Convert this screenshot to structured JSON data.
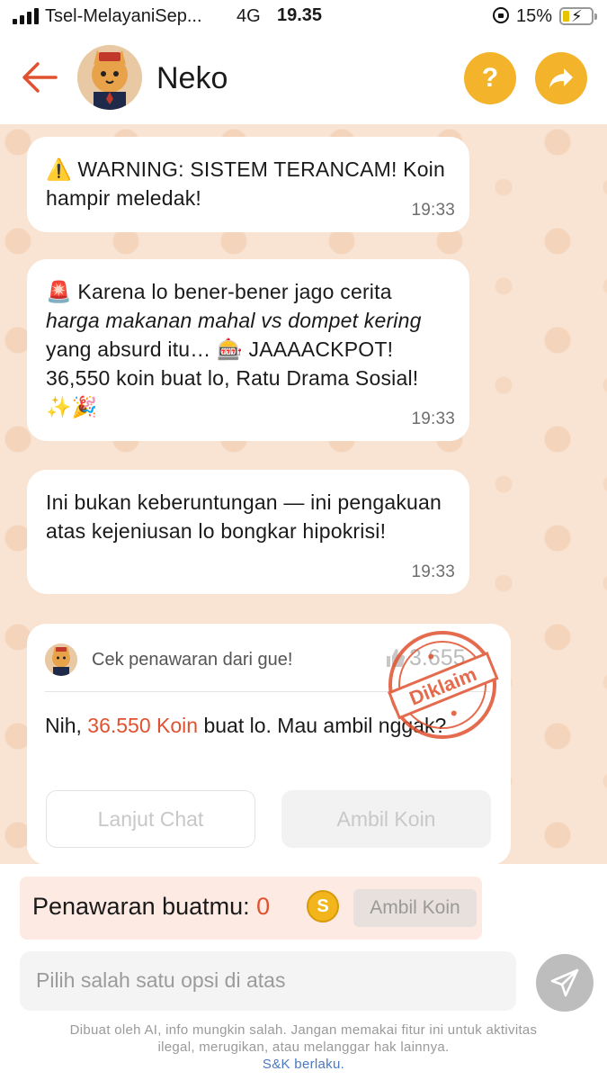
{
  "status_bar": {
    "carrier": "Tsel-MelayaniSep...",
    "network": "4G",
    "time": "19.35",
    "battery_percent": "15%",
    "battery_level": 0.15
  },
  "header": {
    "title": "Neko",
    "help_label": "?",
    "accent_color": "#f3b32a"
  },
  "messages": [
    {
      "text_pre": "⚠️ WARNING: SISTEM TERANCAM! Koin hampir meledak!",
      "time": "19:33"
    },
    {
      "text_pre": "🚨 Karena lo bener-bener jago cerita ",
      "text_italic": "harga makanan mahal vs dompet kering",
      "text_post": " yang absurd itu… 🎰 JAAAACKPOT! 36,550 koin buat lo, Ratu Drama Sosial! ✨🎉",
      "time": "19:33"
    },
    {
      "text_pre": "Ini bukan keberuntungan — ini pengakuan atas kejeniusan lo bongkar hipokrisi!",
      "time": "19:33"
    }
  ],
  "offer_card": {
    "from": "Cek penawaran dari gue!",
    "count": "3.655",
    "text_pre": "Nih, ",
    "amount": "36.550 Koin",
    "text_post": " buat lo. Mau ambil nggak?",
    "stamp": "Diklaim",
    "continue_label": "Lanjut Chat",
    "take_label": "Ambil Koin"
  },
  "offer_bar": {
    "label": "Penawaran buatmu: ",
    "value": "0",
    "coin_symbol": "S",
    "take_label": "Ambil Koin"
  },
  "input": {
    "placeholder": "Pilih salah satu opsi di atas"
  },
  "disclaimer": {
    "line1": "Dibuat oleh AI, info mungkin salah. Jangan memakai fitur ini untuk aktivitas",
    "line2": "ilegal, merugikan, atau melanggar hak lainnya.",
    "link": "S&K berlaku."
  },
  "colors": {
    "accent_red": "#e0522f",
    "chat_background": "#f9e4d3"
  }
}
